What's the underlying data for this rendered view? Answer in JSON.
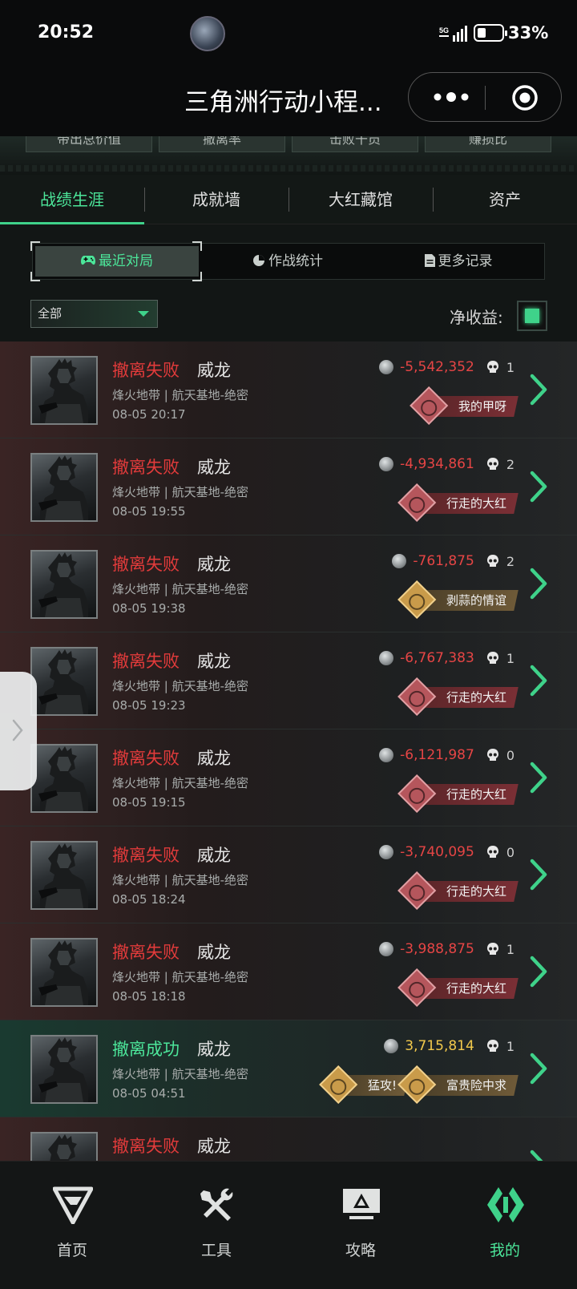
{
  "status_bar": {
    "time": "20:52",
    "signal_label": "5G",
    "battery": "33%"
  },
  "title_bar": {
    "title": "三角洲行动小程..."
  },
  "stats_strip": {
    "buttons": [
      "带出总价值",
      "撤离率",
      "击败干员",
      "赚损比"
    ]
  },
  "main_tabs": [
    {
      "label": "战绩生涯",
      "active": true
    },
    {
      "label": "成就墙",
      "active": false
    },
    {
      "label": "大红藏馆",
      "active": false
    },
    {
      "label": "资产",
      "active": false
    }
  ],
  "sub_tabs": [
    {
      "label": "最近对局",
      "icon": "gamepad-icon",
      "active": true
    },
    {
      "label": "作战统计",
      "icon": "pie-chart-icon",
      "active": false
    },
    {
      "label": "更多记录",
      "icon": "document-icon",
      "active": false
    }
  ],
  "filter": {
    "selected": "全部",
    "net_income_label": "净收益:"
  },
  "colors": {
    "accent": "#3fd28a",
    "fail": "#e23b3b",
    "gain": "#f2c94c"
  },
  "matches": [
    {
      "result": "撤离失败",
      "status": "fail",
      "operator": "威龙",
      "map": "烽火地带 | 航天基地-绝密",
      "time": "08-05 20:17",
      "value": "-5,542,352",
      "kills": "1",
      "badges": [
        {
          "text": "我的甲呀",
          "tone": "red"
        }
      ]
    },
    {
      "result": "撤离失败",
      "status": "fail",
      "operator": "威龙",
      "map": "烽火地带 | 航天基地-绝密",
      "time": "08-05 19:55",
      "value": "-4,934,861",
      "kills": "2",
      "badges": [
        {
          "text": "行走的大红",
          "tone": "red"
        }
      ]
    },
    {
      "result": "撤离失败",
      "status": "fail",
      "operator": "威龙",
      "map": "烽火地带 | 航天基地-绝密",
      "time": "08-05 19:38",
      "value": "-761,875",
      "kills": "2",
      "badges": [
        {
          "text": "剥蒜的情谊",
          "tone": "gold"
        }
      ]
    },
    {
      "result": "撤离失败",
      "status": "fail",
      "operator": "威龙",
      "map": "烽火地带 | 航天基地-绝密",
      "time": "08-05 19:23",
      "value": "-6,767,383",
      "kills": "1",
      "badges": [
        {
          "text": "行走的大红",
          "tone": "red"
        }
      ]
    },
    {
      "result": "撤离失败",
      "status": "fail",
      "operator": "威龙",
      "map": "烽火地带 | 航天基地-绝密",
      "time": "08-05 19:15",
      "value": "-6,121,987",
      "kills": "0",
      "badges": [
        {
          "text": "行走的大红",
          "tone": "red"
        }
      ]
    },
    {
      "result": "撤离失败",
      "status": "fail",
      "operator": "威龙",
      "map": "烽火地带 | 航天基地-绝密",
      "time": "08-05 18:24",
      "value": "-3,740,095",
      "kills": "0",
      "badges": [
        {
          "text": "行走的大红",
          "tone": "red"
        }
      ]
    },
    {
      "result": "撤离失败",
      "status": "fail",
      "operator": "威龙",
      "map": "烽火地带 | 航天基地-绝密",
      "time": "08-05 18:18",
      "value": "-3,988,875",
      "kills": "1",
      "badges": [
        {
          "text": "行走的大红",
          "tone": "red"
        }
      ]
    },
    {
      "result": "撤离成功",
      "status": "win",
      "operator": "威龙",
      "map": "烽火地带 | 航天基地-绝密",
      "time": "08-05 04:51",
      "value": "3,715,814",
      "kills": "1",
      "badges": [
        {
          "text": "猛攻!",
          "tone": "gold"
        },
        {
          "text": "富贵险中求",
          "tone": "gold"
        }
      ]
    },
    {
      "result": "撤离失败",
      "status": "fail",
      "operator": "威龙",
      "map": "",
      "time": "",
      "value": "",
      "kills": "",
      "badges": []
    }
  ],
  "bottom_nav": [
    {
      "label": "首页",
      "icon": "home-logo-icon",
      "active": false
    },
    {
      "label": "工具",
      "icon": "tools-icon",
      "active": false
    },
    {
      "label": "攻略",
      "icon": "guide-monitor-icon",
      "active": false
    },
    {
      "label": "我的",
      "icon": "profile-logo-icon",
      "active": true
    }
  ]
}
